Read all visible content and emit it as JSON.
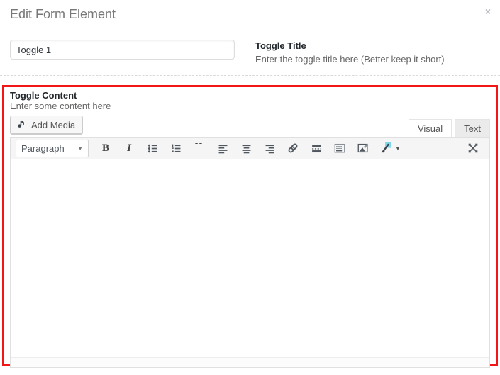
{
  "header": {
    "title": "Edit Form Element",
    "close_glyph": "×"
  },
  "toggle_title": {
    "value": "Toggle 1",
    "label": "Toggle Title",
    "description": "Enter the toggle title here (Better keep it short)"
  },
  "toggle_content": {
    "label": "Toggle Content",
    "description": "Enter some content here"
  },
  "editor": {
    "add_media_label": "Add Media",
    "tabs": [
      {
        "label": "Visual",
        "active": true
      },
      {
        "label": "Text",
        "active": false
      }
    ],
    "format_select": {
      "value": "Paragraph",
      "caret": "▼"
    },
    "content": ""
  },
  "icons": {
    "bold": "B",
    "italic": "I",
    "blockquote": "“",
    "wand_caret": "▼"
  },
  "colors": {
    "highlight_border": "#f21616",
    "toolbar_bg": "#f5f5f5",
    "icon": "#50575e",
    "wand_sparkle": "#82d6ea"
  }
}
